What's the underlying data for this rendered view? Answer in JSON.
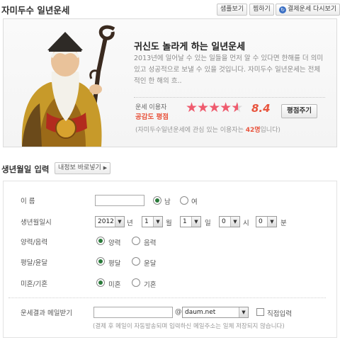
{
  "header": {
    "title": "자미두수 일년운세",
    "buttons": {
      "sample": "샘플보기",
      "bookmark": "찜하기",
      "history": "결제운세 다시보기"
    }
  },
  "product": {
    "title": "귀신도 놀라게 하는 일년운세",
    "description": "2013년에 일어날 수 있는 일들을 먼저 알 수 있다면 한해를 더 의미 있고 성공적으로 보낼 수 있을 것입니다. 자미두수 일년운세는 전체적인 한 해의 흐..",
    "rating_label_1": "운세 이용자",
    "rating_label_2": "공감도 평점",
    "rating": 4.4,
    "score_text": "8.4",
    "rate_button": "평점주기",
    "users_prefix": "(자미두수일년운세에 관심 있는 이용자는 ",
    "users_count": "42명",
    "users_suffix": "입니다)"
  },
  "form_section": {
    "title": "생년월일 입력",
    "profile_button": "내정보 바로넣기"
  },
  "form": {
    "name_label": "이 름",
    "gender_male": "남",
    "gender_female": "여",
    "birth_label": "생년월일시",
    "year": "2012",
    "year_unit": "년",
    "month": "1",
    "month_unit": "월",
    "day": "1",
    "day_unit": "일",
    "hour": "0",
    "hour_unit": "시",
    "minute": "0",
    "minute_unit": "분",
    "calendar_label": "양력/음력",
    "solar": "양력",
    "lunar": "음력",
    "leap_label": "평달/윤달",
    "normal_month": "평달",
    "leap_month": "윤달",
    "marital_label": "미혼/기혼",
    "single": "미혼",
    "married": "기혼",
    "email_label": "운세결과 메일받기",
    "email_at": "@",
    "email_domain": "daum.net",
    "direct_input": "직접입력",
    "note": "(결제 후 메일이 자동발송되며 입력하신 메일주소는 일체 저장되지 않습니다)"
  },
  "colors": {
    "accent_red": "#e8543d",
    "star_pink": "#ef5b6e",
    "radio_green": "#2a7a3a"
  }
}
